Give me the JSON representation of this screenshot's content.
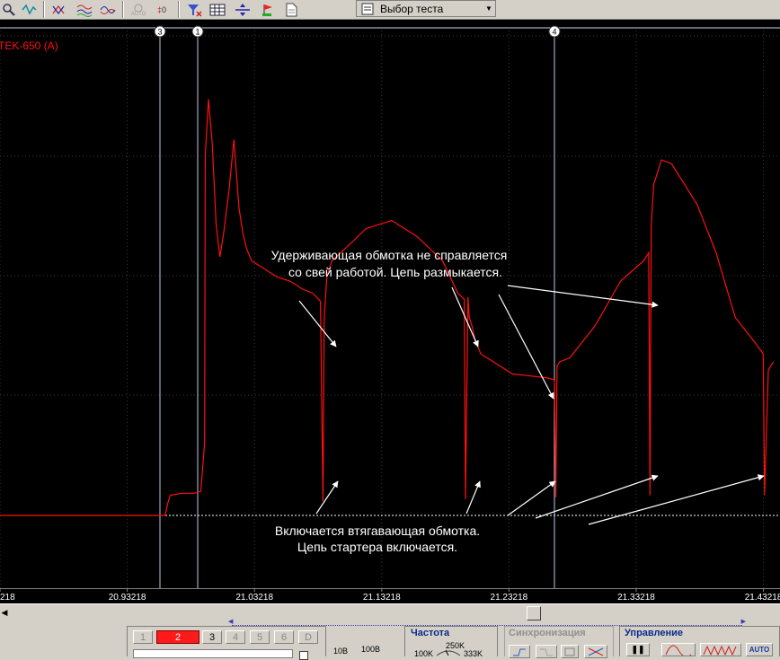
{
  "toolbar": {
    "test_select_label": "Выбор теста",
    "auto_label": "AUTO",
    "zero_label": "0"
  },
  "scope": {
    "channel_label": "TEK-650 (A)",
    "markers": [
      "3",
      "1",
      "4"
    ],
    "annotation_top": [
      "Удерживающая обмотка не справляется",
      "со свей работой. Цепь размыкается."
    ],
    "annotation_bottom": [
      "Включается втягавающая обмотка.",
      "Цепь стартера включается."
    ],
    "colors": {
      "trace": "#ff1010",
      "marker": "#b8c8e8",
      "annotation": "#ffffff",
      "background": "#000000"
    }
  },
  "chart_data": {
    "type": "line",
    "x_ticks": [
      "218",
      "20.93218",
      "21.03218",
      "21.13218",
      "21.23218",
      "21.33218",
      "21.43218"
    ],
    "xlim": [
      20.83218,
      21.44518
    ],
    "grid": true,
    "series": [
      {
        "x": [
          20.832,
          20.962,
          20.964,
          20.966,
          20.975,
          20.985,
          20.99,
          20.993,
          20.9935,
          20.996,
          20.999,
          21.002,
          21.005,
          21.008,
          21.012,
          21.016,
          21.02,
          21.023,
          21.026,
          21.03,
          21.04,
          21.05,
          21.06,
          21.07,
          21.078,
          21.084,
          21.086,
          21.087,
          21.089,
          21.091,
          21.093,
          21.1,
          21.11,
          21.12,
          21.14,
          21.16,
          21.18,
          21.192,
          21.197,
          21.198,
          21.199,
          21.2,
          21.201,
          21.203,
          21.206,
          21.21,
          21.22,
          21.235,
          21.25,
          21.263,
          21.268,
          21.269,
          21.27,
          21.272,
          21.28,
          21.3,
          21.32,
          21.338,
          21.342,
          21.343,
          21.344,
          21.346,
          21.352,
          21.36,
          21.38,
          21.395,
          21.41,
          21.425,
          21.432,
          21.433,
          21.436,
          21.44
        ],
        "y": [
          1.0,
          1.0,
          1.3,
          1.5,
          1.55,
          1.55,
          1.6,
          2.8,
          9.9,
          11.3,
          10.2,
          8.2,
          7.4,
          8.0,
          9.0,
          10.3,
          8.6,
          8.0,
          7.6,
          7.3,
          7.1,
          6.9,
          6.8,
          6.6,
          6.5,
          6.3,
          1.35,
          5.9,
          6.9,
          7.1,
          7.3,
          7.5,
          7.8,
          8.1,
          8.3,
          7.9,
          7.3,
          6.5,
          6.35,
          1.4,
          4.0,
          6.4,
          5.9,
          5.7,
          5.3,
          5.0,
          4.8,
          4.5,
          4.45,
          4.4,
          4.35,
          1.45,
          4.7,
          4.8,
          4.9,
          5.7,
          6.8,
          7.3,
          7.5,
          1.5,
          8.2,
          9.2,
          9.8,
          9.7,
          8.7,
          7.5,
          5.9,
          5.3,
          5.0,
          1.5,
          4.6,
          4.8
        ]
      }
    ]
  },
  "bottom": {
    "channels": [
      "1",
      "2",
      "3",
      "4",
      "5",
      "6",
      "D"
    ],
    "active_channel": "2",
    "range_labels": [
      "10В",
      "100В"
    ],
    "freq_title": "Частота",
    "freq_labels": [
      "250K",
      "100K",
      "333K"
    ],
    "sync_title": "Синхронизация",
    "control_title": "Управление",
    "control_auto": "AUTO"
  }
}
